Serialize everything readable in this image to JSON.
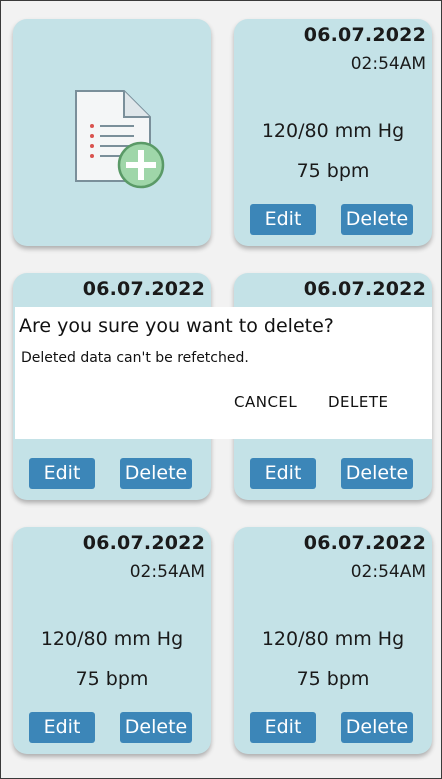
{
  "add_card": {
    "icon": "add-document-icon"
  },
  "records": [
    {
      "date": "06.07.2022",
      "time": "02:54AM",
      "bp": "120/80 mm Hg",
      "pulse": "75 bpm",
      "edit_label": "Edit",
      "delete_label": "Delete"
    },
    {
      "date": "06.07.2022",
      "time": "",
      "bp": "",
      "pulse": "",
      "edit_label": "Edit",
      "delete_label": "Delete"
    },
    {
      "date": "06.07.2022",
      "time": "",
      "bp": "",
      "pulse": "",
      "edit_label": "Edit",
      "delete_label": "Delete"
    },
    {
      "date": "06.07.2022",
      "time": "02:54AM",
      "bp": "120/80 mm Hg",
      "pulse": "75 bpm",
      "edit_label": "Edit",
      "delete_label": "Delete"
    },
    {
      "date": "06.07.2022",
      "time": "02:54AM",
      "bp": "120/80 mm Hg",
      "pulse": "75 bpm",
      "edit_label": "Edit",
      "delete_label": "Delete"
    }
  ],
  "dialog": {
    "title": "Are you sure you want to delete?",
    "message": "Deleted data can't be refetched.",
    "cancel_label": "CANCEL",
    "confirm_label": "DELETE"
  },
  "colors": {
    "card_bg": "#c4e2e7",
    "button_bg": "#3c86b8",
    "page_bg": "#f2f2f2"
  }
}
